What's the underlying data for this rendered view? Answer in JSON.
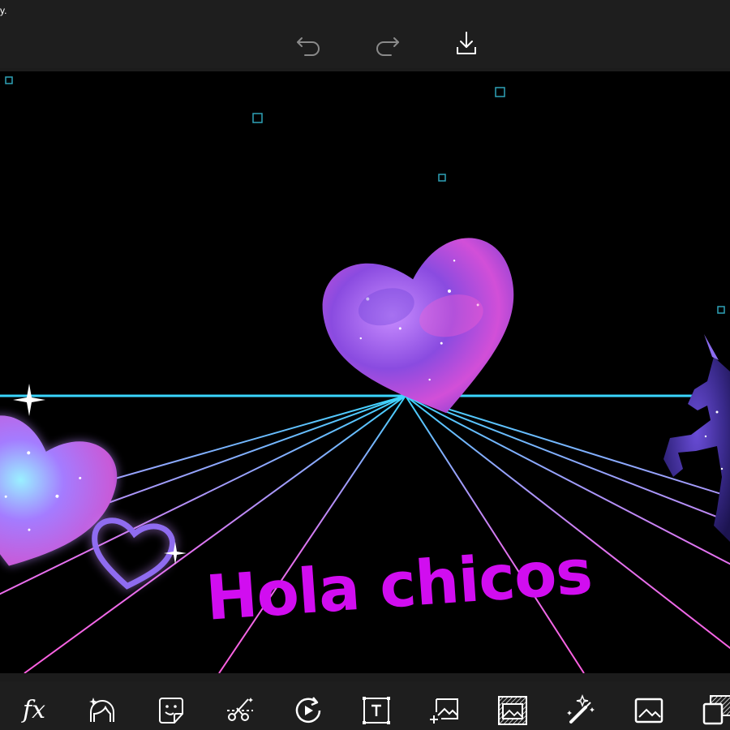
{
  "status_text": "y.",
  "toolbar": {
    "undo_icon": "undo-icon",
    "redo_icon": "redo-icon",
    "download_icon": "download-icon"
  },
  "canvas": {
    "caption": "Hola chicos",
    "caption_color": "#d10df0",
    "background_color": "#000000",
    "grid_colors": [
      "#3ad6ff",
      "#ff5fe0"
    ],
    "stickers": [
      "galaxy-heart",
      "glowing-heart",
      "outline-heart",
      "galaxy-unicorn"
    ]
  },
  "tools": [
    {
      "name": "effects-tool",
      "glyph": "fx"
    },
    {
      "name": "beautify-tool",
      "icon": "face-sparkle-icon"
    },
    {
      "name": "sticker-tool",
      "icon": "sticker-icon"
    },
    {
      "name": "cutout-tool",
      "icon": "scissors-icon"
    },
    {
      "name": "animation-tool",
      "icon": "rotate-play-icon"
    },
    {
      "name": "text-tool",
      "icon": "text-box-icon"
    },
    {
      "name": "add-photo-tool",
      "icon": "add-photo-icon"
    },
    {
      "name": "border-tool",
      "icon": "hatched-frame-icon"
    },
    {
      "name": "draw-tool",
      "icon": "magic-brush-icon"
    },
    {
      "name": "frame-tool",
      "icon": "image-icon"
    },
    {
      "name": "square-fit-tool",
      "icon": "layers-icon"
    }
  ]
}
